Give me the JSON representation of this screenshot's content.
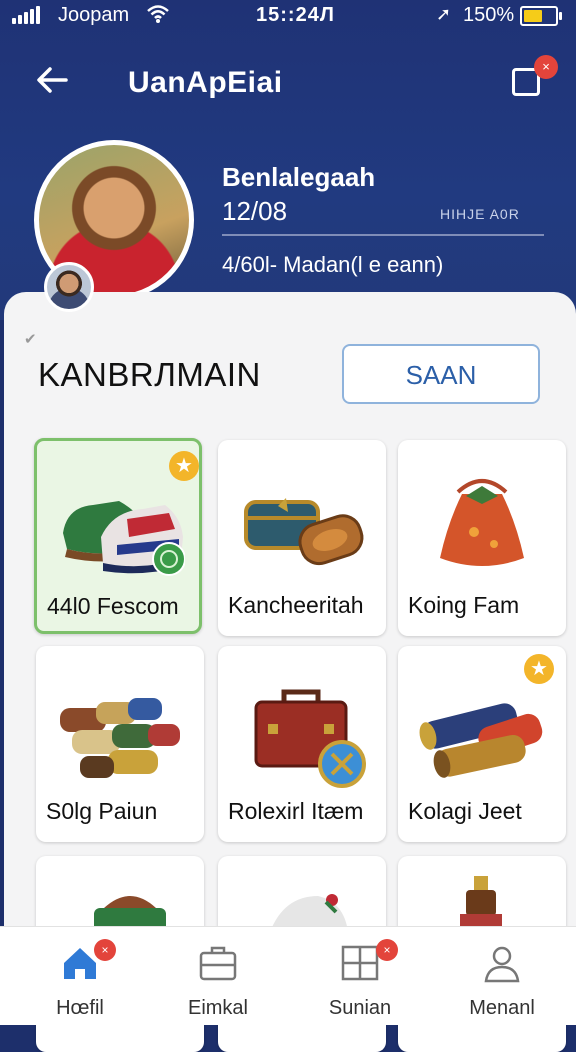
{
  "status_bar": {
    "carrier": "Joopam",
    "time": "15::24Л",
    "battery": "150%"
  },
  "header": {
    "title": "UanApEiai",
    "share_badge": "×"
  },
  "profile": {
    "name": "Benlalegaah",
    "date": "12/08",
    "code": "HIHJE A0R",
    "subtitle": "4/60l- Madan(l e eann)"
  },
  "section": {
    "title": "KANBRЛMAIN",
    "button_label": "SAAN"
  },
  "items": [
    {
      "label": "44l0 Fescom",
      "icon": "sneakers-icon",
      "selected": true,
      "starred": true
    },
    {
      "label": "Kancheeritah",
      "icon": "chest-icon",
      "selected": false,
      "starred": false
    },
    {
      "label": "Koing Fam",
      "icon": "pouch-icon",
      "selected": false,
      "starred": false
    },
    {
      "label": "S0lg Paiun",
      "icon": "scrolls-icon",
      "selected": false,
      "starred": false
    },
    {
      "label": "Rolexirl Itæm",
      "icon": "suitcase-icon",
      "selected": false,
      "starred": false
    },
    {
      "label": "Kolagi Jeet",
      "icon": "rolls-icon",
      "selected": false,
      "starred": true
    }
  ],
  "nav": [
    {
      "label": "Hœfil",
      "icon": "home-icon",
      "active": true,
      "badge": "×"
    },
    {
      "label": "Eimkal",
      "icon": "briefcase-icon",
      "active": false,
      "badge": ""
    },
    {
      "label": "Sunian",
      "icon": "grid-icon",
      "active": false,
      "badge": "×"
    },
    {
      "label": "Menanl",
      "icon": "user-icon",
      "active": false,
      "badge": ""
    }
  ],
  "colors": {
    "header_bg": "#1f3275",
    "accent": "#2b5fa8",
    "selected_border": "#7dc06b",
    "badge": "#e3443b",
    "star": "#f3b52a"
  }
}
